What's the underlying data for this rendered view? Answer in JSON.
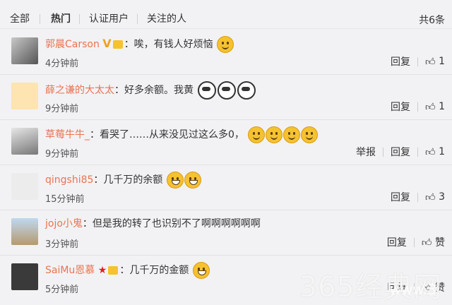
{
  "tabs": [
    {
      "label": "全部"
    },
    {
      "label": "热门"
    },
    {
      "label": "认证用户"
    },
    {
      "label": "关注的人"
    }
  ],
  "total": "共6条",
  "reply_label": "回复",
  "report_label": "举报",
  "like_label": "赞",
  "colors": {
    "username": "#eb7350",
    "background": "#f2f2f5"
  },
  "comments": [
    {
      "user": "郭晨Carson",
      "text": "：唉，有钱人好烦恼",
      "time": "4分钟前",
      "likes": "1"
    },
    {
      "user": "薛之谦的大太太",
      "text": "：好多余额。我黄",
      "time": "9分钟前",
      "likes": "1"
    },
    {
      "user": "草莓牛牛_",
      "text": "：看哭了……从来没见过这么多0，",
      "time": "9分钟前",
      "likes": "1"
    },
    {
      "user": "qingshi85",
      "text": "：几千万的余额",
      "time": "15分钟前",
      "likes": "3"
    },
    {
      "user": "jojo小鬼",
      "text": "：但是我的转了也识别不了啊啊啊啊啊啊",
      "time": "3分钟前",
      "likes": "赞"
    },
    {
      "user": "SaiMu恩慕",
      "text": "：几千万的金额",
      "time": "5分钟前",
      "likes": "赞"
    }
  ],
  "watermark": "365经典网",
  "watermark_url": "www.3"
}
